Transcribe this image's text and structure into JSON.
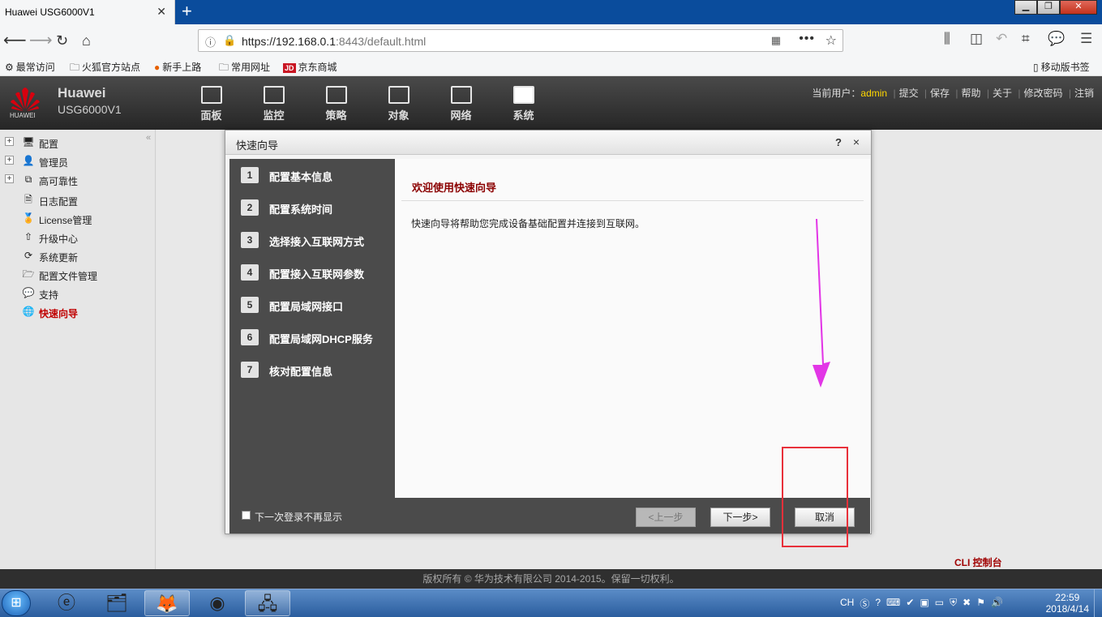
{
  "browser": {
    "tab_title": "Huawei USG6000V1",
    "url_host": "https://192.168.0.1",
    "url_rest": ":8443/default.html",
    "bookmarks": [
      "最常访问",
      "火狐官方站点",
      "新手上路",
      "常用网址",
      "京东商城"
    ],
    "jd_logo": "JD",
    "mobile_bookmarks": "移动版书签"
  },
  "app": {
    "logo_text": "HUAWEI",
    "brand": "Huawei",
    "model": "USG6000V1",
    "nav": [
      "面板",
      "监控",
      "策略",
      "对象",
      "网络",
      "系统"
    ],
    "active_nav": "系统",
    "user_label": "当前用户：",
    "user_name": "admin",
    "user_actions": [
      "提交",
      "保存",
      "帮助",
      "关于",
      "修改密码",
      "注销"
    ]
  },
  "sidebar": {
    "items": [
      {
        "label": "配置",
        "expandable": true
      },
      {
        "label": "管理员",
        "expandable": true
      },
      {
        "label": "高可靠性",
        "expandable": true
      },
      {
        "label": "日志配置",
        "expandable": false
      },
      {
        "label": "License管理",
        "expandable": false
      },
      {
        "label": "升级中心",
        "expandable": false
      },
      {
        "label": "系统更新",
        "expandable": false
      },
      {
        "label": "配置文件管理",
        "expandable": false
      },
      {
        "label": "支持",
        "expandable": false
      },
      {
        "label": "快速向导",
        "expandable": false,
        "active": true
      }
    ]
  },
  "dialog": {
    "title": "快速向导",
    "help": "?",
    "close": "×",
    "steps": [
      {
        "num": "1",
        "label": "配置基本信息"
      },
      {
        "num": "2",
        "label": "配置系统时间"
      },
      {
        "num": "3",
        "label": "选择接入互联网方式"
      },
      {
        "num": "4",
        "label": "配置接入互联网参数"
      },
      {
        "num": "5",
        "label": "配置局域网接口"
      },
      {
        "num": "6",
        "label": "配置局域网DHCP服务"
      },
      {
        "num": "7",
        "label": "核对配置信息"
      }
    ],
    "panel_title": "欢迎使用快速向导",
    "panel_desc": "快速向导将帮助您完成设备基础配置并连接到互联网。",
    "dont_show_label": "下一次登录不再显示",
    "prev_label": "<上一步",
    "next_label": "下一步>",
    "cancel_label": "取消"
  },
  "cli_label": "CLI 控制台",
  "footer": "版权所有 © 华为技术有限公司 2014-2015。保留一切权利。",
  "taskbar": {
    "tray_lang": "CH",
    "time": "22:59",
    "date": "2018/4/14"
  },
  "colors": {
    "tab_bar": "#0a4c9c",
    "header_dark": "#262626",
    "panel_title": "#8b0000",
    "active_sidebar": "#c00000",
    "annotation_box": "#e8303a",
    "annotation_arrow": "#e236e6",
    "user_name": "#ffd700"
  }
}
